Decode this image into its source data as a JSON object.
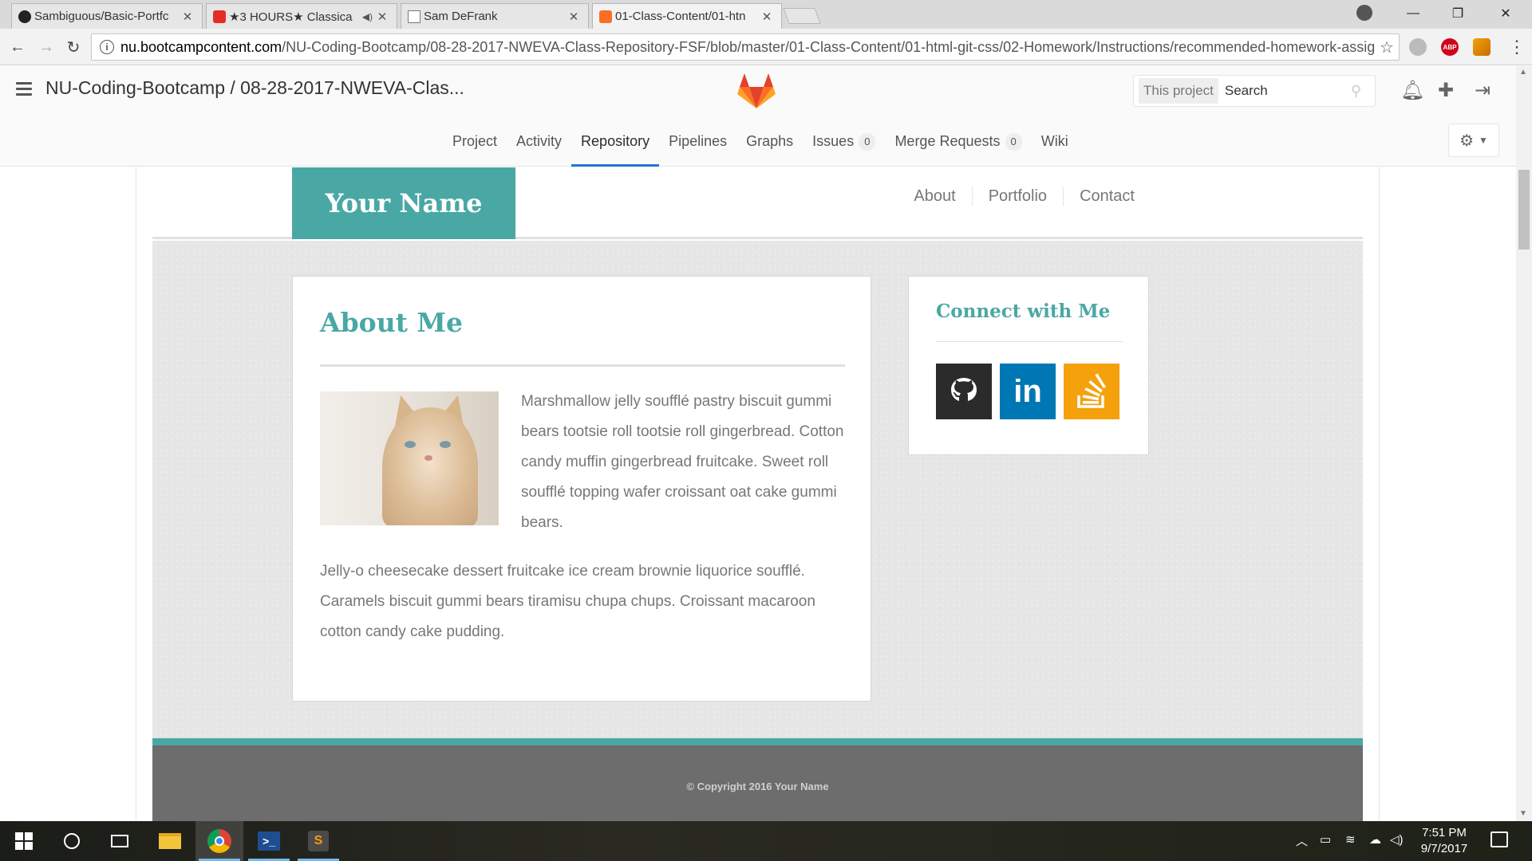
{
  "browser": {
    "tabs": [
      {
        "title": "Sambiguous/Basic-Portfc",
        "icon": "github-icon"
      },
      {
        "title": "★3 HOURS★ Classica",
        "icon": "youtube-icon"
      },
      {
        "title": "Sam DeFrank",
        "icon": "document-icon"
      },
      {
        "title": "01-Class-Content/01-htn",
        "icon": "gitlab-icon"
      }
    ],
    "url_host": "nu.bootcampcontent.com",
    "url_path": "/NU-Coding-Bootcamp/08-28-2017-NWEVA-Class-Repository-FSF/blob/master/01-Class-Content/01-html-git-css/02-Homework/Instructions/recommended-homework-assig...",
    "abp_label": "ABP"
  },
  "gitlab": {
    "breadcrumb": "NU-Coding-Bootcamp / 08-28-2017-NWEVA-Clas...",
    "search_scope": "This project",
    "search_placeholder": "Search",
    "nav": [
      {
        "label": "Project"
      },
      {
        "label": "Activity"
      },
      {
        "label": "Repository",
        "active": true
      },
      {
        "label": "Pipelines"
      },
      {
        "label": "Graphs"
      },
      {
        "label": "Issues",
        "badge": "0"
      },
      {
        "label": "Merge Requests",
        "badge": "0"
      },
      {
        "label": "Wiki"
      }
    ],
    "accent_color": "#1f78d1",
    "logo_colors": [
      "#e24329",
      "#fc6d26",
      "#fca326"
    ]
  },
  "site": {
    "brand": "Your Name",
    "nav": [
      "About",
      "Portfolio",
      "Contact"
    ],
    "about": {
      "title": "About Me",
      "paragraph1": "Marshmallow jelly soufflé pastry biscuit gummi bears tootsie roll tootsie roll gingerbread. Cotton candy muffin gingerbread fruitcake. Sweet roll soufflé topping wafer croissant oat cake gummi bears.",
      "paragraph2": "Jelly-o cheesecake dessert fruitcake ice cream brownie liquorice soufflé. Caramels biscuit gummi bears tiramisu chupa chups. Croissant macaroon cotton candy cake pudding."
    },
    "connect": {
      "title": "Connect with Me",
      "links": [
        {
          "name": "github-icon",
          "label": ""
        },
        {
          "name": "linkedin-icon",
          "label": "in"
        },
        {
          "name": "stackoverflow-icon",
          "label": ""
        }
      ]
    },
    "footer": "© Copyright 2016 Your Name",
    "theme_color": "#4aa8a4"
  },
  "taskbar": {
    "time": "7:51 PM",
    "date": "9/7/2017",
    "apps": [
      "start",
      "cortana",
      "task-view",
      "file-explorer",
      "chrome",
      "powershell",
      "sublime-text"
    ]
  }
}
